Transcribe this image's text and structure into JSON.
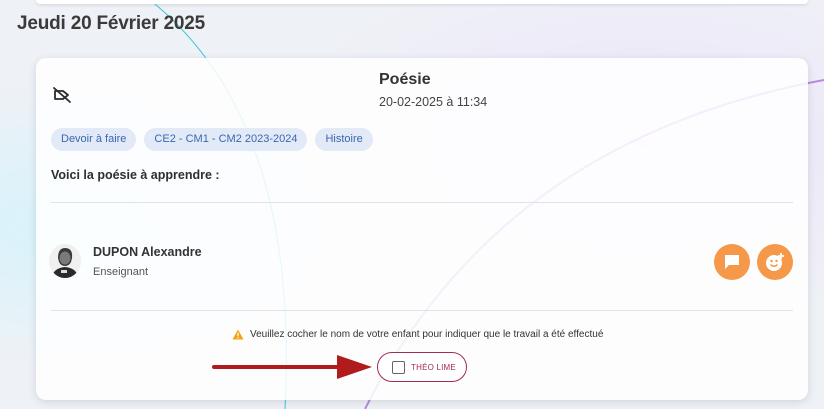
{
  "header": {
    "date": "Jeudi 20 Février 2025"
  },
  "post": {
    "title": "Poésie",
    "datetime": "20-02-2025 à 11:34",
    "icon": "tag-off-icon",
    "tags": [
      "Devoir à faire",
      "CE2 - CM1 - CM2 2023-2024",
      "Histoire"
    ],
    "body": "Voici la poésie à apprendre :"
  },
  "author": {
    "name": "DUPON Alexandre",
    "role": "Enseignant",
    "actions": [
      "chat-bubble-icon",
      "add-reaction-icon"
    ]
  },
  "completion": {
    "warning": "Veuillez cocher le nom de votre enfant pour indiquer que le travail a été effectué",
    "child_label": "THÉO LIME",
    "checked": false
  },
  "colors": {
    "accent": "#f5984a",
    "tag_bg": "#e2eaf7",
    "tag_text": "#3a67b0",
    "checkbox_border": "#a32a5a",
    "arrow": "#b01c1c"
  }
}
